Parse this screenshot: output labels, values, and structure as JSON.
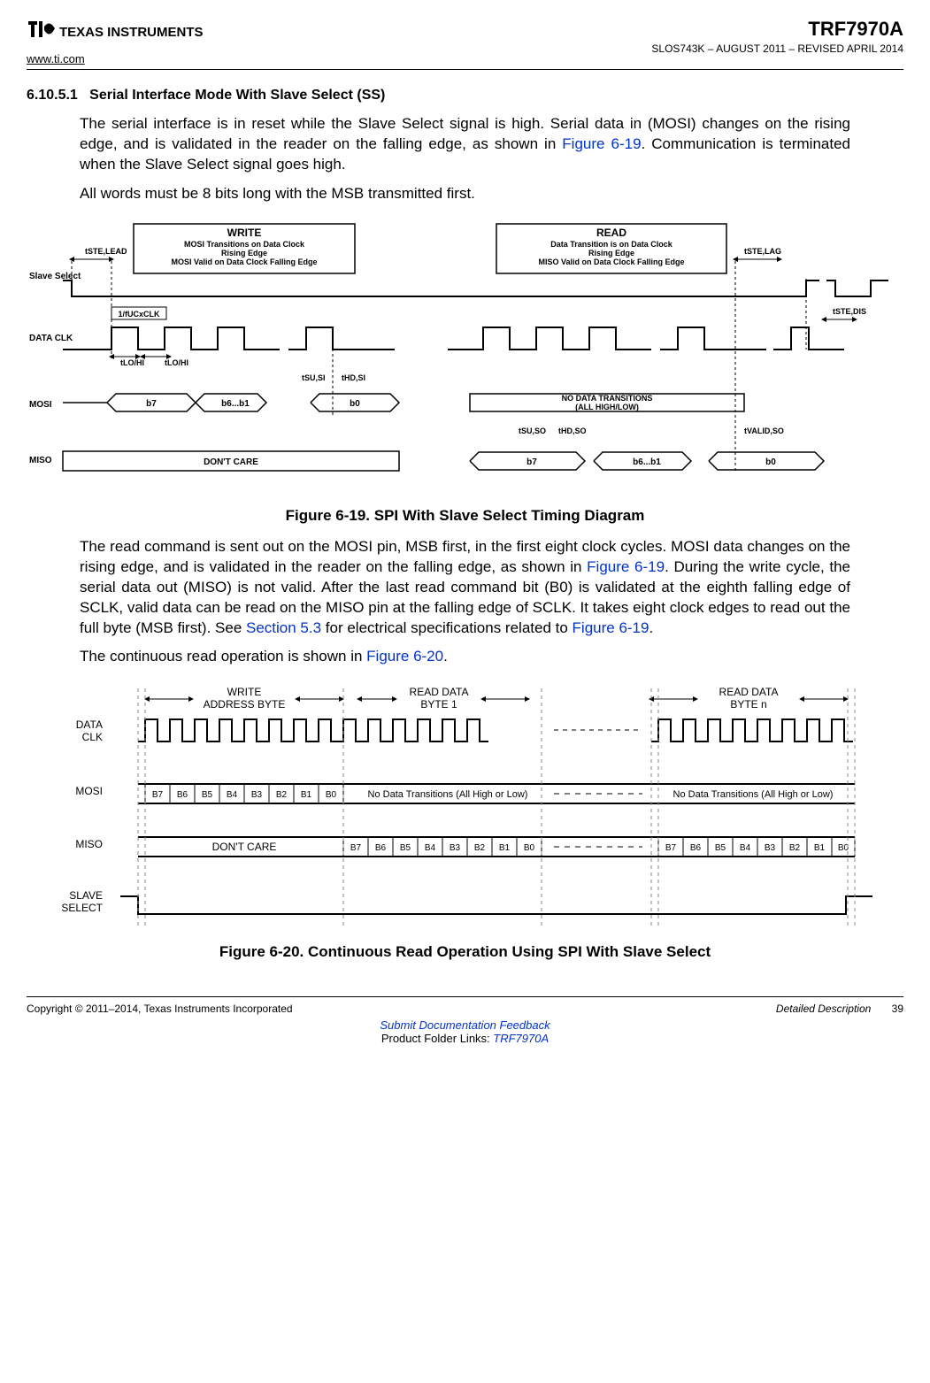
{
  "header": {
    "company": "TEXAS INSTRUMENTS",
    "url": "www.ti.com",
    "part": "TRF7970A",
    "docid": "SLOS743K – AUGUST 2011 – REVISED APRIL 2014"
  },
  "section": {
    "num": "6.10.5.1",
    "title": "Serial Interface Mode With Slave Select (SS)"
  },
  "para1_a": "The serial interface is in reset while the Slave Select signal is high. Serial data in (MOSI) changes on the rising edge, and is validated in the reader on the falling edge, as shown in ",
  "para1_link": "Figure 6-19",
  "para1_b": ". Communication is terminated when the Slave Select signal goes high.",
  "para2": "All words must be 8 bits long with the MSB transmitted first.",
  "fig619": {
    "caption": "Figure 6-19. SPI With Slave Select Timing Diagram",
    "write_box_title": "WRITE",
    "write_box_l1": "MOSI Transitions on Data Clock",
    "write_box_l2": "Rising Edge",
    "write_box_l3": "MOSI Valid on Data Clock Falling Edge",
    "read_box_title": "READ",
    "read_box_l1": "Data Transition is on Data Clock",
    "read_box_l2": "Rising Edge",
    "read_box_l3": "MISO Valid on Data Clock Falling Edge",
    "labels": {
      "slave_select": "Slave Select",
      "data_clk": "DATA CLK",
      "mosi": "MOSI",
      "miso": "MISO",
      "t_ste_lead": "tSTE,LEAD",
      "t_ste_lag": "tSTE,LAG",
      "t_ste_dis": "tSTE,DIS",
      "freq": "1/fUCxCLK",
      "t_lo_hi": "tLO/HI",
      "t_su_si": "tSU,SI",
      "t_hd_si": "tHD,SI",
      "t_su_so": "tSU,SO",
      "t_hd_so": "tHD,SO",
      "t_valid_so": "tVALID,SO",
      "b7": "b7",
      "b6b1": "b6...b1",
      "b0": "b0",
      "no_data": "NO DATA TRANSITIONS",
      "no_data2": "(ALL HIGH/LOW)",
      "dont_care": "DON'T CARE"
    }
  },
  "para3_a": "The read command is sent out on the MOSI pin, MSB first, in the first eight clock cycles. MOSI data changes on the rising edge, and is validated in the reader on the falling edge, as shown in ",
  "para3_link1": "Figure 6-19",
  "para3_b": ". During the write cycle, the serial data out (MISO) is not valid. After the last read command bit (B0) is validated at the eighth falling edge of SCLK, valid data can be read on the MISO pin at the falling edge of SCLK. It takes eight clock edges to read out the full byte (MSB first). See ",
  "para3_link2": "Section 5.3",
  "para3_c": " for electrical specifications related to ",
  "para3_link3": "Figure 6-19",
  "para3_d": ".",
  "para4_a": "The continuous read operation is shown in ",
  "para4_link": "Figure 6-20",
  "para4_b": ".",
  "fig620": {
    "caption": "Figure 6-20. Continuous Read Operation Using SPI With Slave Select",
    "labels": {
      "write_addr": "WRITE",
      "write_addr2": "ADDRESS BYTE",
      "read1": "READ DATA",
      "read1b": "BYTE 1",
      "readn": "READ DATA",
      "readnb": "BYTE n",
      "data_clk": "DATA CLK",
      "mosi": "MOSI",
      "miso": "MISO",
      "slave_select": "SLAVE SELECT",
      "bits": [
        "B7",
        "B6",
        "B5",
        "B4",
        "B3",
        "B2",
        "B1",
        "B0"
      ],
      "no_data": "No Data Transitions (All High or Low)",
      "dont_care": "DON'T CARE"
    }
  },
  "footer": {
    "copyright": "Copyright © 2011–2014, Texas Instruments Incorporated",
    "section": "Detailed Description",
    "page": "39",
    "feedback": "Submit Documentation Feedback",
    "folder_pre": "Product Folder Links: ",
    "folder_link": "TRF7970A"
  }
}
